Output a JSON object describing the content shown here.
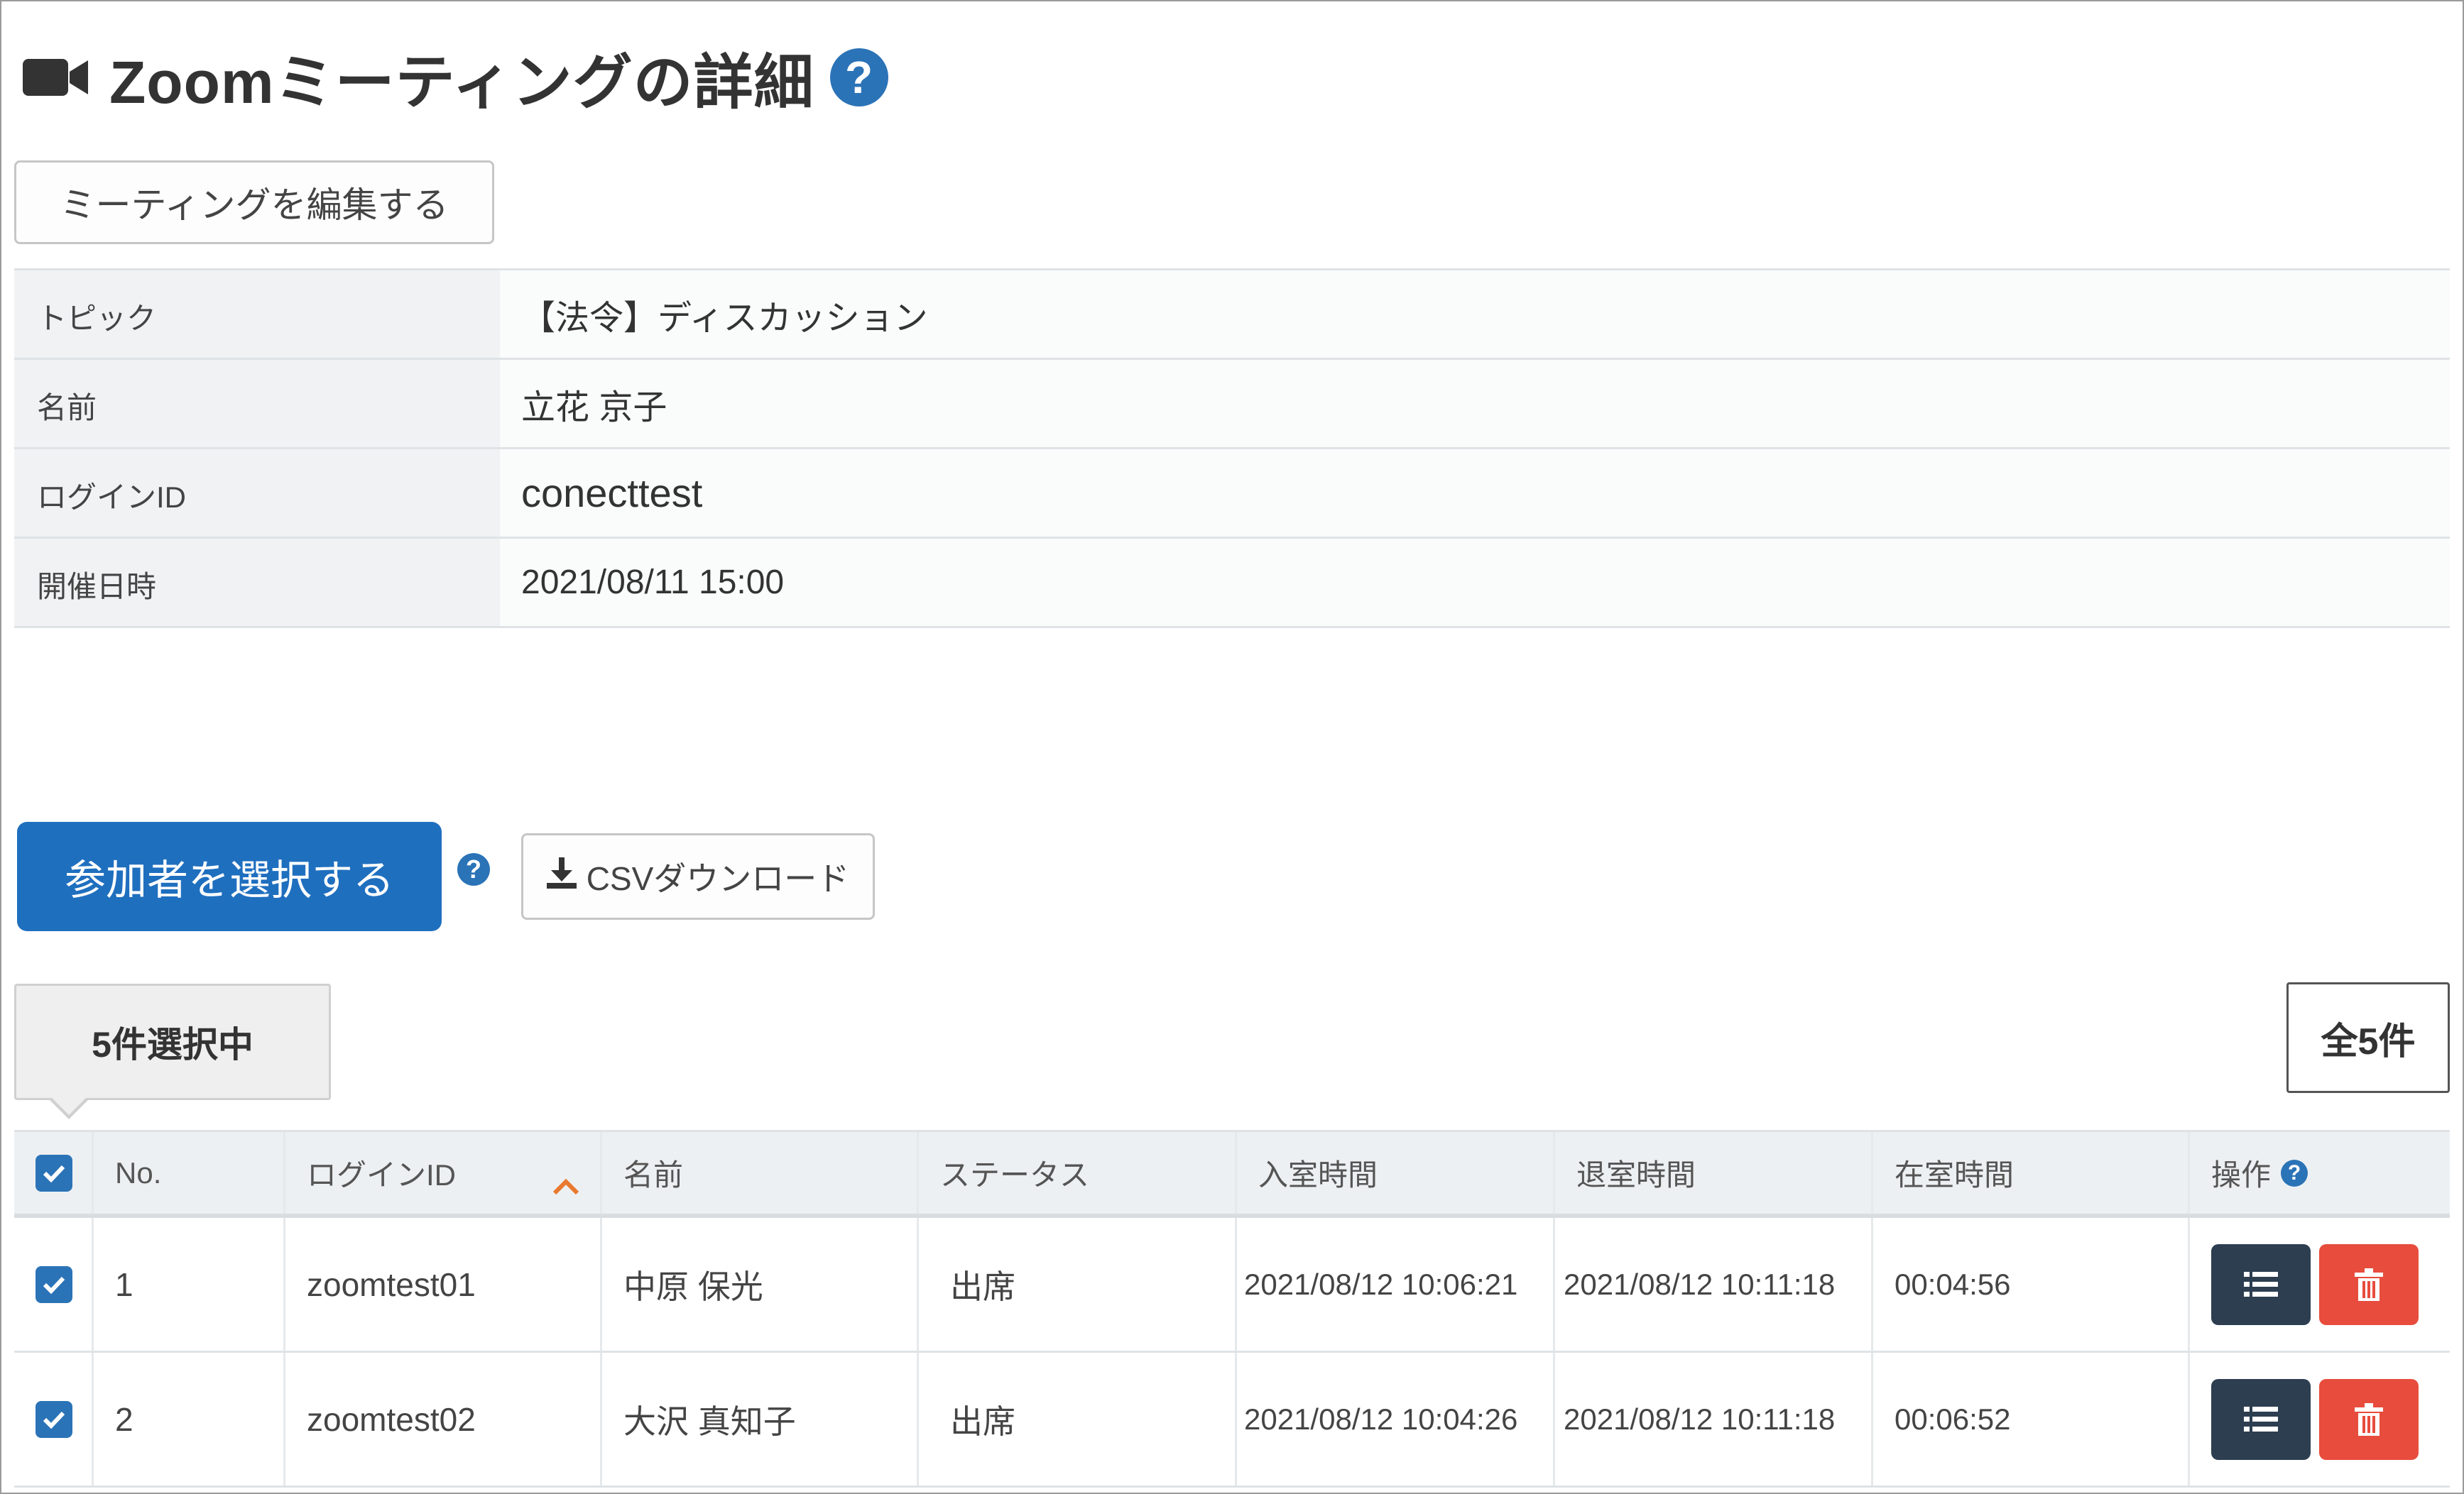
{
  "page": {
    "title": "Zoomミーティングの詳細",
    "help_glyph": "?",
    "icons": {
      "title": "video-camera-icon",
      "help": "question-circle-icon",
      "download": "download-icon",
      "sort": "chevron-up-icon",
      "list": "list-icon",
      "delete": "trash-icon",
      "checkbox": "checkbox-checked-icon"
    }
  },
  "edit_button": {
    "label": "ミーティングを編集する"
  },
  "details": [
    {
      "label": "トピック",
      "value": "【法令】ディスカッション"
    },
    {
      "label": "名前",
      "value": "立花 京子"
    },
    {
      "label": "ログインID",
      "value": "conecttest"
    },
    {
      "label": "開催日時",
      "value": "2021/08/11 15:00"
    }
  ],
  "actions": {
    "select_participants": "参加者を選択する",
    "csv_download": "CSVダウンロード"
  },
  "selection": {
    "selected_label": "5件選択中",
    "total_label": "全5件"
  },
  "participants": {
    "columns": [
      "No.",
      "ログインID",
      "名前",
      "ステータス",
      "入室時間",
      "退室時間",
      "在室時間",
      "操作"
    ],
    "rows": [
      {
        "no": "1",
        "login_id": "zoomtest01",
        "name": "中原 保光",
        "status": "出席",
        "enter": "2021/08/12 10:06:21",
        "exit": "2021/08/12 10:11:18",
        "duration": "00:04:56"
      },
      {
        "no": "2",
        "login_id": "zoomtest02",
        "name": "大沢 真知子",
        "status": "出席",
        "enter": "2021/08/12 10:04:26",
        "exit": "2021/08/12 10:11:18",
        "duration": "00:06:52"
      }
    ]
  },
  "colors": {
    "primary": "#1f6fbf",
    "help": "#2b73b7",
    "danger": "#e74c3c",
    "dark": "#2d3e50",
    "sort_accent": "#e8792f"
  }
}
